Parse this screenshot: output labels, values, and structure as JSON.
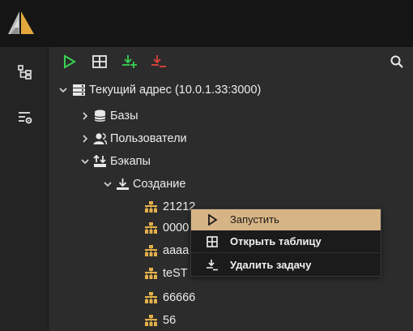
{
  "tree": {
    "root": "Текущий адрес (10.0.1.33:3000)",
    "bases": "Базы",
    "users": "Пользователи",
    "backups": "Бэкапы",
    "creation": "Создание",
    "tasks": [
      "21212",
      "0000",
      "aaaa",
      "teST",
      "66666",
      "56"
    ]
  },
  "context_menu": {
    "run": "Запустить",
    "open_table": "Открыть таблицу",
    "delete_task": "Удалить задачу"
  },
  "colors": {
    "accent": "#d7b485",
    "green": "#39d353",
    "red": "#e0443c",
    "gold": "#e3b04b"
  }
}
